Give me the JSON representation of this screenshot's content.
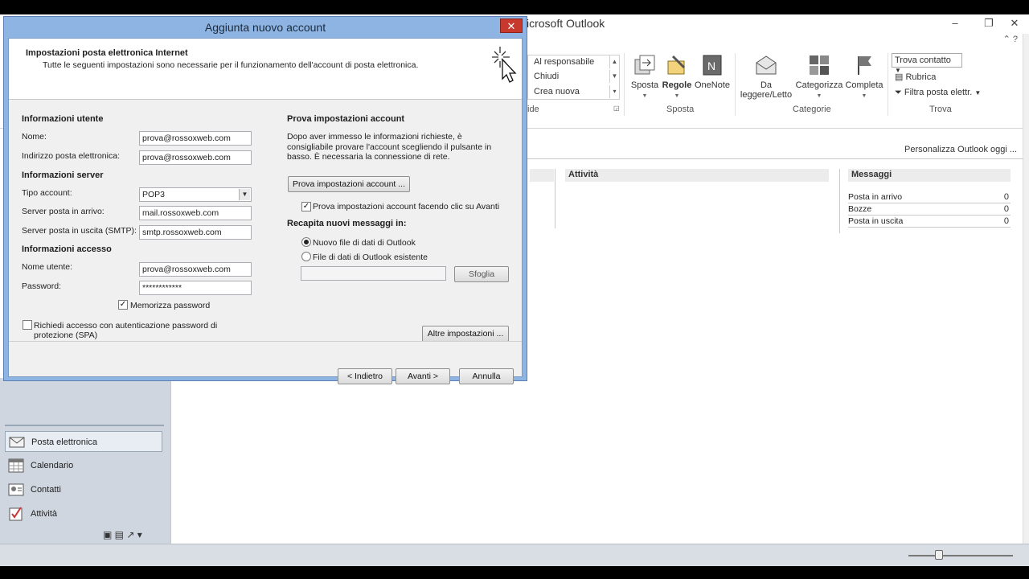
{
  "outlook": {
    "title": "icrosoft Outlook",
    "ribbon": {
      "quick_steps": [
        "Al responsabile",
        "Chiudi",
        "Crea nuova"
      ],
      "quick_group_label": "ide",
      "move_group": {
        "label": "Sposta",
        "buttons": [
          "Sposta",
          "Regole",
          "OneNote"
        ]
      },
      "tags_group": {
        "label": "Categorie",
        "buttons": [
          "Da leggere/Letto",
          "Categorizza",
          "Completa"
        ]
      },
      "find_group": {
        "label": "Trova",
        "search_placeholder": "Trova contatto",
        "items": [
          "Rubrica",
          "Filtra posta elettr."
        ]
      }
    },
    "today": {
      "customize_link": "Personalizza Outlook oggi ...",
      "tasks_header": "Attività",
      "messages_header": "Messaggi",
      "messages": [
        {
          "label": "Posta in arrivo",
          "count": "0"
        },
        {
          "label": "Bozze",
          "count": "0"
        },
        {
          "label": "Posta in uscita",
          "count": "0"
        }
      ]
    },
    "nav": [
      {
        "label": "Posta elettronica",
        "icon": "mail-icon"
      },
      {
        "label": "Calendario",
        "icon": "calendar-icon"
      },
      {
        "label": "Contatti",
        "icon": "contacts-icon"
      },
      {
        "label": "Attività",
        "icon": "tasks-icon"
      }
    ]
  },
  "dialog": {
    "title": "Aggiunta nuovo account",
    "close_label": "✕",
    "header_title": "Impostazioni posta elettronica Internet",
    "header_subtitle": "Tutte le seguenti impostazioni sono necessarie per il funzionamento dell'account di posta elettronica.",
    "user_info": {
      "title": "Informazioni utente",
      "name_label": "Nome:",
      "name_value": "prova@rossoxweb.com",
      "email_label": "Indirizzo posta elettronica:",
      "email_value": "prova@rossoxweb.com"
    },
    "server_info": {
      "title": "Informazioni server",
      "account_type_label": "Tipo account:",
      "account_type_value": "POP3",
      "incoming_label": "Server posta in arrivo:",
      "incoming_value": "mail.rossoxweb.com",
      "outgoing_label": "Server posta in uscita (SMTP):",
      "outgoing_value": "smtp.rossoxweb.com"
    },
    "login_info": {
      "title": "Informazioni accesso",
      "username_label": "Nome utente:",
      "username_value": "prova@rossoxweb.com",
      "password_label": "Password:",
      "password_value": "************",
      "remember_label": "Memorizza password",
      "remember_checked": true,
      "spa_label": "Richiedi accesso con autenticazione password di protezione (SPA)",
      "spa_checked": false
    },
    "test_settings": {
      "title": "Prova impostazioni account",
      "description": "Dopo aver immesso le informazioni richieste, è consigliabile provare l'account scegliendo il pulsante in basso. È necessaria la connessione di rete.",
      "test_button": "Prova impostazioni account ...",
      "auto_test_label": "Prova impostazioni account facendo clic su Avanti",
      "auto_test_checked": true
    },
    "delivery": {
      "title": "Recapita nuovi messaggi in:",
      "option_new": "Nuovo file di dati di Outlook",
      "option_existing": "File di dati di Outlook esistente",
      "selected": "new",
      "path_value": "",
      "browse_button": "Sfoglia"
    },
    "more_settings_button": "Altre impostazioni ...",
    "back_button": "< Indietro",
    "next_button": "Avanti >",
    "cancel_button": "Annulla"
  },
  "colors": {
    "dialog_frame": "#8db4e3",
    "close_button": "#c7382d",
    "nav_background": "#cfd6df"
  }
}
